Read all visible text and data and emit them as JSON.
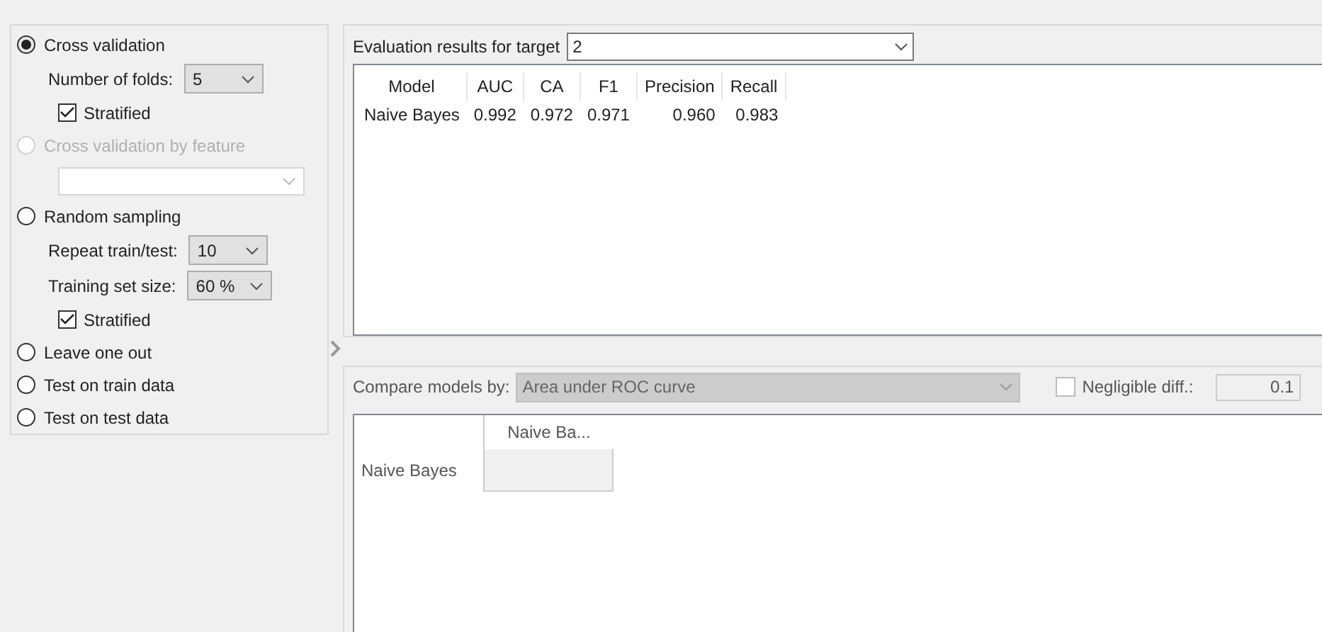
{
  "sampling": {
    "options": [
      {
        "kind": "radio",
        "label": "Cross validation",
        "selected": true,
        "disabled": false
      },
      {
        "kind": "dropdown",
        "label": "Number of folds:",
        "value": "5"
      },
      {
        "kind": "checkbox",
        "label": "Stratified",
        "checked": true
      },
      {
        "kind": "radio",
        "label": "Cross validation by feature",
        "selected": false,
        "disabled": true
      },
      {
        "kind": "blank_dropdown"
      },
      {
        "kind": "radio",
        "label": "Random sampling",
        "selected": false,
        "disabled": false
      },
      {
        "kind": "dropdown",
        "label": "Repeat train/test:",
        "value": "10"
      },
      {
        "kind": "dropdown",
        "label": "Training set size:",
        "value": "60 %"
      },
      {
        "kind": "checkbox",
        "label": "Stratified",
        "checked": true
      },
      {
        "kind": "radio",
        "label": "Leave one out",
        "selected": false,
        "disabled": false
      },
      {
        "kind": "radio",
        "label": "Test on train data",
        "selected": false,
        "disabled": false
      },
      {
        "kind": "radio",
        "label": "Test on test data",
        "selected": false,
        "disabled": false
      }
    ]
  },
  "results": {
    "target_label": "Evaluation results for target",
    "target_value": "2",
    "table": {
      "columns": [
        "Model",
        "AUC",
        "CA",
        "F1",
        "Precision",
        "Recall"
      ],
      "rows": [
        [
          "Naive Bayes",
          "0.992",
          "0.972",
          "0.971",
          "0.960",
          "0.983"
        ]
      ]
    }
  },
  "comparison": {
    "label": "Compare models by:",
    "value": "Area under ROC curve",
    "negligible": {
      "label": "Negligible diff.:",
      "checked": false,
      "value": "0.1"
    },
    "matrix": {
      "columns": [
        "Naive Ba..."
      ],
      "rows": [
        "Naive Bayes"
      ]
    }
  }
}
